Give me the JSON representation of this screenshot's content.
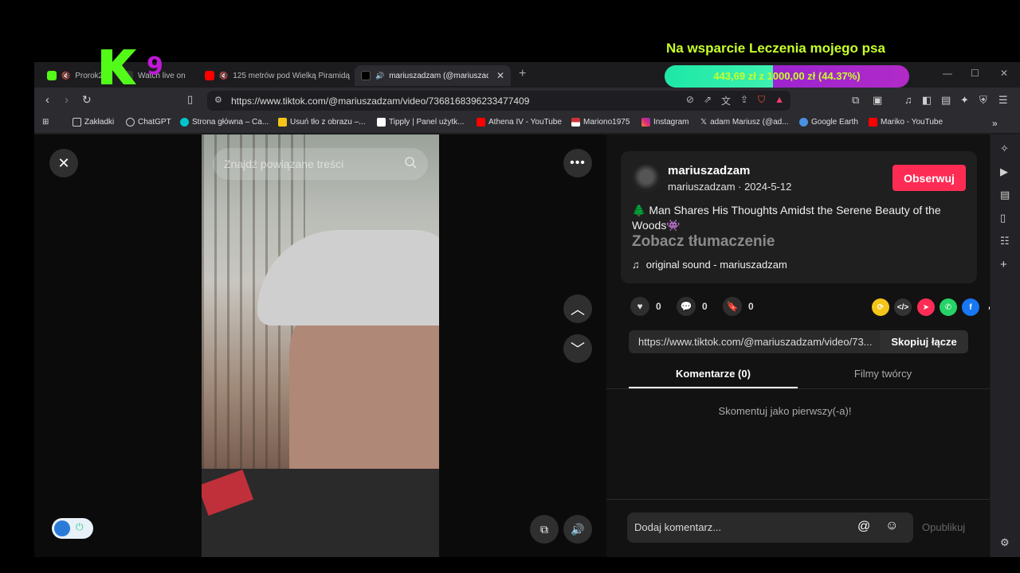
{
  "overlay": {
    "donation_title": "Na wsparcie Leczenia mojego psa",
    "donation_progress": "443,69 zł z 1000,00 zł (44.37%)",
    "donation_fraction": 0.4437,
    "logo_number": "9"
  },
  "tabs": [
    {
      "title": "Prorok2"
    },
    {
      "title": "Watch live on"
    },
    {
      "title": "125 metrów pod Wielką Piramidą"
    },
    {
      "title": "mariuszadzam (@mariuszadz"
    }
  ],
  "url": "https://www.tiktok.com/@mariuszadzam/video/7368168396233477409",
  "bookmarks": [
    "Zakładki",
    "ChatGPT",
    "Strona główna – Ca...",
    "Usuń tło z obrazu –...",
    "Tipply | Panel użytk...",
    "Athena IV - YouTube",
    "Mariono1975",
    "Instagram",
    "adam Mariusz (@ad...",
    "Google Earth",
    "Mariko - YouTube"
  ],
  "video": {
    "search_placeholder": "Znajdź powiązane treści"
  },
  "post": {
    "username": "mariuszadzam",
    "handle_date": "mariuszadzam · 2024-5-12",
    "follow_label": "Obserwuj",
    "description": "🌲 Man Shares His Thoughts Amidst the Serene Beauty of the Woods👾",
    "translate_label": "Zobacz tłumaczenie",
    "sound": "original sound - mariuszadzam",
    "likes": "0",
    "comments": "0",
    "saves": "0",
    "link": "https://www.tiktok.com/@mariuszadzam/video/73...",
    "copy_label": "Skopiuj łącze",
    "tab_comments": "Komentarze (0)",
    "tab_creator": "Filmy twórcy",
    "no_comments": "Skomentuj jako pierwszy(-a)!",
    "comment_placeholder": "Dodaj komentarz...",
    "publish_label": "Opublikuj"
  }
}
